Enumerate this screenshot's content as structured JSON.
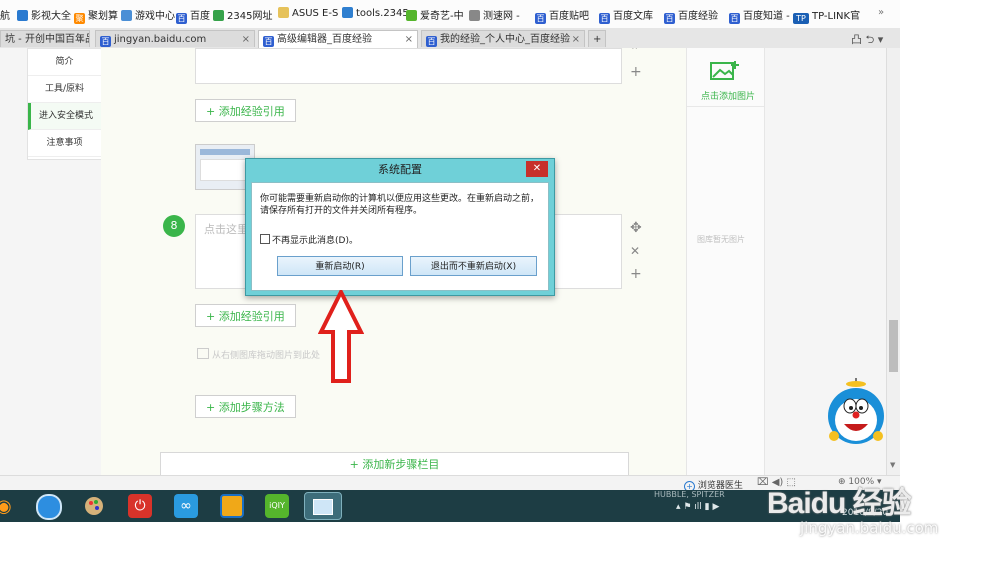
{
  "bookmarks": [
    {
      "label": "航",
      "icon": "bookmark-icon"
    },
    {
      "label": "影视大全",
      "icon": "video-icon"
    },
    {
      "label": "聚划算",
      "icon": "ju-icon"
    },
    {
      "label": "游戏中心",
      "icon": "game-icon"
    },
    {
      "label": "百度",
      "icon": "baidu-icon"
    },
    {
      "label": "2345网址",
      "icon": "site-2345-icon"
    },
    {
      "label": "ASUS E-S",
      "icon": "folder-icon"
    },
    {
      "label": "tools.2345",
      "icon": "tools-icon"
    },
    {
      "label": "爱奇艺-中",
      "icon": "iqiyi-icon"
    },
    {
      "label": "测速网 -",
      "icon": "speed-icon"
    },
    {
      "label": "百度贴吧",
      "icon": "baidu-icon"
    },
    {
      "label": "百度文库",
      "icon": "baidu-icon"
    },
    {
      "label": "百度经验",
      "icon": "baidu-icon"
    },
    {
      "label": "百度知道 -",
      "icon": "baidu-icon"
    },
    {
      "label": "TP-LINK官",
      "icon": "tplink-icon"
    }
  ],
  "tabs": [
    {
      "label": "坑 - 开创中国百年品"
    },
    {
      "label": "jingyan.baidu.com"
    },
    {
      "label": "高级编辑器_百度经验"
    },
    {
      "label": "我的经验_个人中心_百度经验"
    }
  ],
  "sidebar": {
    "items": [
      {
        "label": "简介"
      },
      {
        "label": "工具/原料"
      },
      {
        "label": "进入安全模式"
      },
      {
        "label": "注意事项"
      }
    ]
  },
  "editor": {
    "add_reference": "+ 添加经验引用",
    "step_number": "8",
    "step_placeholder": "点击这里",
    "add_reference_2": "+ 添加经验引用",
    "drag_hint": "从右侧图库拖动图片到此处",
    "add_step_method": "+ 添加步骤方法",
    "add_new_step": "+ 添加新步骤栏目"
  },
  "right_panel": {
    "add_image": "点击添加图片",
    "no_image": "图库暂无图片"
  },
  "dialog": {
    "title": "系统配置",
    "message": "你可能需要重新启动你的计算机以便应用这些更改。在重新启动之前，请保存所有打开的文件并关闭所有程序。",
    "checkbox_label": "不再显示此消息(D)。",
    "restart_button": "重新启动(R)",
    "exit_button": "退出而不重新启动(X)"
  },
  "status_bar": {
    "doctor": "浏览器医生",
    "zoom": "100%"
  },
  "taskbar": {
    "tray_text": "HUBBLE, SPITZER",
    "date": "2016/8/20"
  },
  "watermark": {
    "logo": "Baidu 经验",
    "url": "jingyan.baidu.com"
  },
  "colors": {
    "accent_green": "#3ab54a",
    "dialog_frame": "#6fd0d8",
    "arrow_red": "#e0201b"
  }
}
